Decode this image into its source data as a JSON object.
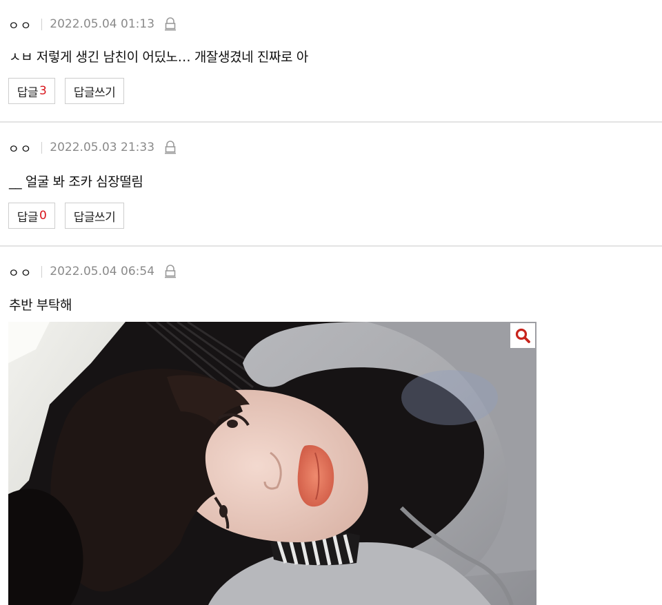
{
  "comments": [
    {
      "nickname": "ㅇㅇ",
      "date": "2022.05.04 01:13",
      "text": "ㅅㅂ 저렇게 생긴 남친이 어딨노… 개잘생겼네 진짜로 아",
      "reply_label": "답글",
      "reply_count": "3",
      "write_label": "답글쓰기"
    },
    {
      "nickname": "ㅇㅇ",
      "date": "2022.05.03 21:33",
      "text": "__ 얼굴 봐 조카 심장떨림",
      "reply_label": "답글",
      "reply_count": "0",
      "write_label": "답글쓰기"
    },
    {
      "nickname": "ㅇㅇ",
      "date": "2022.05.04 06:54",
      "text": "추반 부탁해",
      "image": {
        "icon": "magnifier-icon",
        "accent_color": "#c8241c"
      }
    }
  ],
  "colors": {
    "count_red": "#d8141b",
    "meta_gray": "#8a8a8a",
    "divider": "#e3e3e3"
  }
}
